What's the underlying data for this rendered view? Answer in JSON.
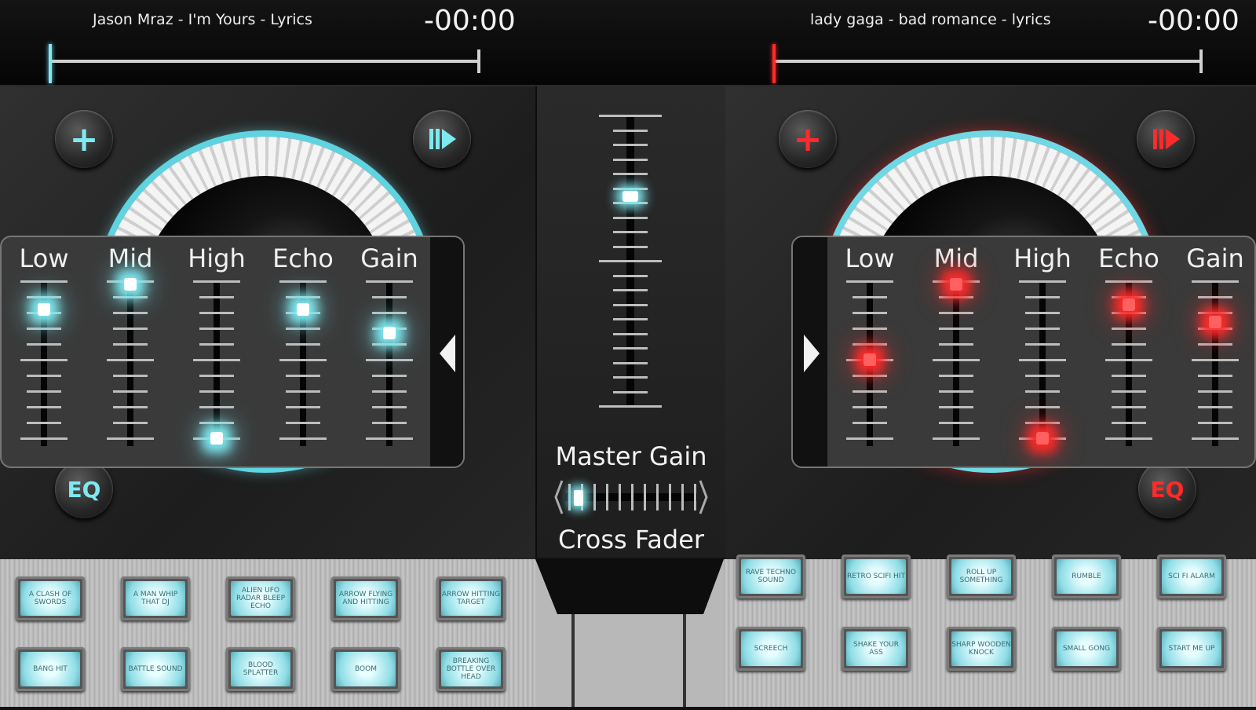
{
  "deckA": {
    "track": "Jason Mraz - I'm Yours - Lyrics",
    "time": "-00:00",
    "accent": "#7ee9f0",
    "add_icon": "+",
    "eq_label": "EQ",
    "eq": [
      {
        "label": "Low",
        "value": 0.82
      },
      {
        "label": "Mid",
        "value": 0.98
      },
      {
        "label": "High",
        "value": 0.0
      },
      {
        "label": "Echo",
        "value": 0.82
      },
      {
        "label": "Gain",
        "value": 0.67
      }
    ]
  },
  "deckB": {
    "track": "lady gaga - bad romance - lyrics",
    "time": "-00:00",
    "accent": "#ff2a2a",
    "add_icon": "+",
    "eq_label": "EQ",
    "eq": [
      {
        "label": "Low",
        "value": 0.5
      },
      {
        "label": "Mid",
        "value": 0.98
      },
      {
        "label": "High",
        "value": 0.0
      },
      {
        "label": "Echo",
        "value": 0.85
      },
      {
        "label": "Gain",
        "value": 0.74
      }
    ]
  },
  "mixer": {
    "master_gain_label": "Master Gain",
    "cross_fader_label": "Cross Fader",
    "master_gain_value": 0.72,
    "cross_fader_value": 0.1
  },
  "padsA": [
    [
      "A CLASH OF SWORDS",
      "A MAN WHIP THAT DJ",
      "ALIEN UFO RADAR BLEEP ECHO",
      "ARROW FLYING AND HITTING",
      "ARROW HITTING TARGET"
    ],
    [
      "BANG HIT",
      "BATTLE SOUND",
      "BLOOD SPLATTER",
      "BOOM",
      "BREAKING BOTTLE OVER HEAD"
    ]
  ],
  "padsB": [
    [
      "RAVE TECHNO SOUND",
      "RETRO SCIFI HIT",
      "ROLL UP SOMETHING",
      "RUMBLE",
      "SCI FI ALARM"
    ],
    [
      "SCREECH",
      "SHAKE YOUR ASS",
      "SHARP WOODEN KNOCK",
      "SMALL GONG",
      "START ME UP"
    ]
  ]
}
